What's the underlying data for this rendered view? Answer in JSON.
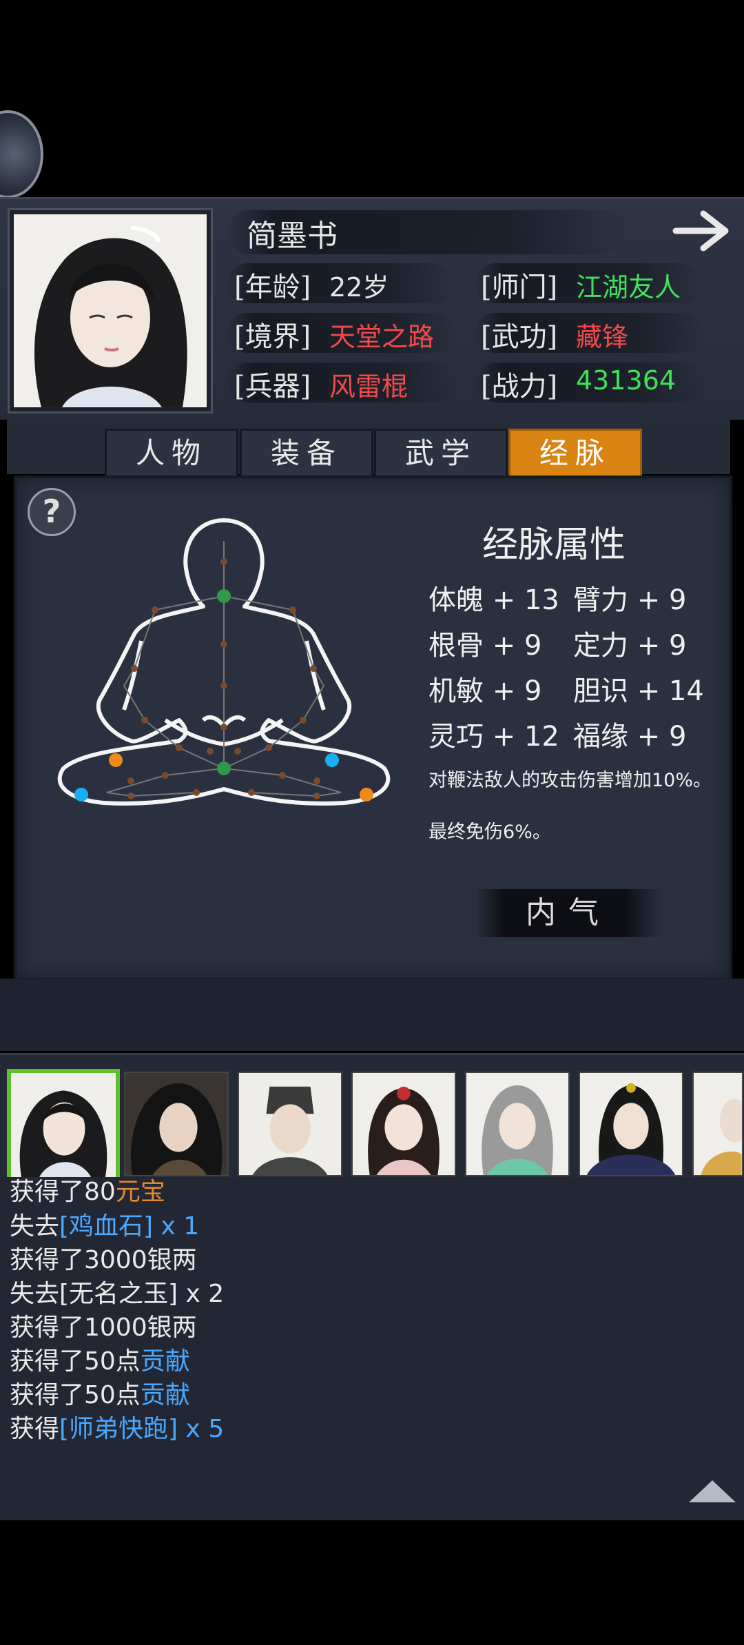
{
  "header": {
    "name": "简墨书",
    "age_label": "[年龄]",
    "age_value": "22岁",
    "school_label": "[师门]",
    "school_value": "江湖友人",
    "realm_label": "[境界]",
    "realm_value": "天堂之路",
    "martial_label": "[武功]",
    "martial_value": "藏锋",
    "weapon_label": "[兵器]",
    "weapon_value": "风雷棍",
    "power_label": "[战力]",
    "power_value": "431364"
  },
  "tabs": [
    {
      "label": "人物",
      "active": false
    },
    {
      "label": "装备",
      "active": false
    },
    {
      "label": "武学",
      "active": false
    },
    {
      "label": "经脉",
      "active": true
    }
  ],
  "meridian": {
    "title": "经脉属性",
    "attrs": [
      {
        "left": "体魄 + 13",
        "right": "臂力 + 9"
      },
      {
        "left": "根骨 + 9",
        "right": "定力 + 9"
      },
      {
        "left": "机敏 + 9",
        "right": "胆识 + 14"
      },
      {
        "left": "灵巧 + 12",
        "right": "福缘 + 9"
      }
    ],
    "note1": "对鞭法敌人的攻击伤害增加10%。",
    "note2": "最终免伤6%。",
    "button": "内气"
  },
  "log": [
    {
      "prefix": "获得了80",
      "item": "元宝",
      "suffix": "",
      "color": "orange"
    },
    {
      "prefix": "失去",
      "item": "[鸡血石]",
      "suffix": " x 1",
      "color": "blue"
    },
    {
      "prefix": "获得了3000银两",
      "item": "",
      "suffix": "",
      "color": ""
    },
    {
      "prefix": "失去[无名之玉] x 2",
      "item": "",
      "suffix": "",
      "color": ""
    },
    {
      "prefix": "获得了1000银两",
      "item": "",
      "suffix": "",
      "color": ""
    },
    {
      "prefix": "获得了50点",
      "item": "贡献",
      "suffix": "",
      "color": "blue"
    },
    {
      "prefix": "获得了50点",
      "item": "贡献",
      "suffix": "",
      "color": "blue"
    },
    {
      "prefix": "获得",
      "item": "[师弟快跑]",
      "suffix": " x 5",
      "color": "blue"
    }
  ],
  "colors": {
    "accent_tab": "#d98312",
    "red_value": "#f24a4a",
    "green_value": "#3fe25a",
    "item_blue": "#4aa8ff",
    "item_orange": "#e58a2a",
    "selected_avatar": "#5fc12a"
  },
  "icons": {
    "help": "question-mark-icon",
    "next": "arrow-right-icon",
    "scroll": "triangle-up-icon"
  }
}
